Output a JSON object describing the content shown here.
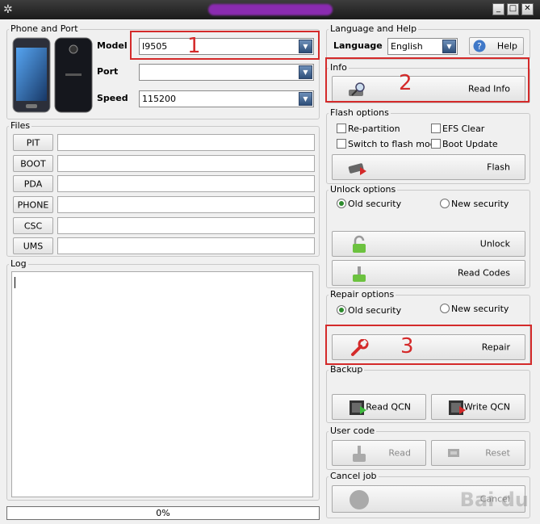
{
  "window": {
    "title_icon": "gear-icon",
    "buttons": [
      "_",
      "□",
      "✕"
    ]
  },
  "phone_port": {
    "title": "Phone and Port",
    "model_label": "Model",
    "model_value": "I9505",
    "port_label": "Port",
    "port_value": "",
    "speed_label": "Speed",
    "speed_value": "115200"
  },
  "files": {
    "title": "Files",
    "buttons": [
      "PIT",
      "BOOT",
      "PDA",
      "PHONE",
      "CSC",
      "UMS"
    ]
  },
  "log": {
    "title": "Log",
    "value": ""
  },
  "progress": {
    "text": "0%",
    "value": 0
  },
  "language_help": {
    "title": "Language and Help",
    "language_label": "Language",
    "language_value": "English",
    "help_label": "Help"
  },
  "info": {
    "title": "Info",
    "read_info_label": "Read Info"
  },
  "flash": {
    "title": "Flash options",
    "repartition": "Re-partition",
    "efs_clear": "EFS Clear",
    "switch_flash": "Switch to flash mode",
    "boot_update": "Boot Update",
    "flash_label": "Flash"
  },
  "unlock": {
    "title": "Unlock options",
    "old_security": "Old security",
    "new_security": "New security",
    "unlock_label": "Unlock",
    "read_codes_label": "Read Codes"
  },
  "repair": {
    "title": "Repair options",
    "old_security": "Old security",
    "new_security": "New security",
    "repair_label": "Repair"
  },
  "backup": {
    "title": "Backup",
    "read_qcn": "Read QCN",
    "write_qcn": "Write QCN"
  },
  "user_code": {
    "title": "User code",
    "read": "Read",
    "reset": "Reset"
  },
  "cancel_job": {
    "title": "Cancel job",
    "cancel": "Cancel"
  },
  "annotations": [
    "1",
    "2",
    "3"
  ],
  "accent": {
    "red": "#d42a2a",
    "green": "#2c8a2c"
  }
}
